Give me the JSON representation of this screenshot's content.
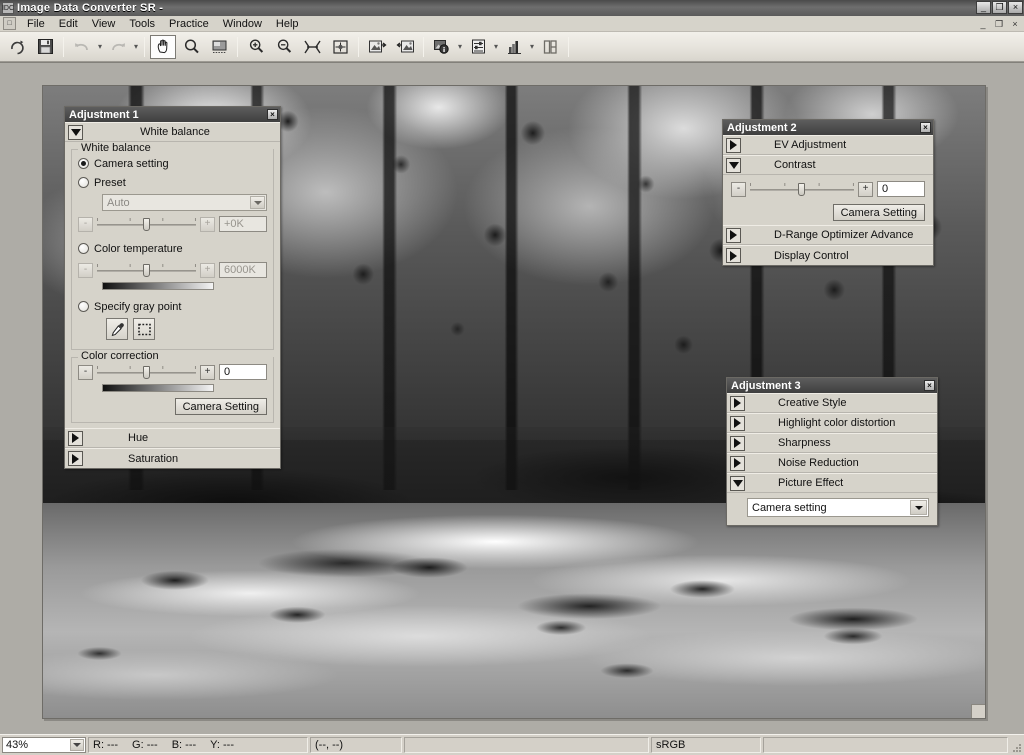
{
  "window": {
    "title": "Image Data Converter SR -",
    "app_icon": "app-icon",
    "controls": {
      "minimize": "_",
      "maximize": "❐",
      "close": "×"
    },
    "mdi_controls": {
      "minimize": "_",
      "restore": "❐",
      "close": "×"
    }
  },
  "menubar": {
    "items": [
      {
        "label": "File"
      },
      {
        "label": "Edit"
      },
      {
        "label": "View"
      },
      {
        "label": "Tools"
      },
      {
        "label": "Practice"
      },
      {
        "label": "Window"
      },
      {
        "label": "Help"
      }
    ]
  },
  "toolbar": {
    "buttons": [
      {
        "name": "rotate-icon",
        "glyph": "rotate",
        "state": "enabled"
      },
      {
        "name": "save-icon",
        "glyph": "save",
        "state": "enabled"
      },
      {
        "name": "undo-icon",
        "glyph": "undo",
        "state": "disabled"
      },
      {
        "name": "redo-icon",
        "glyph": "redo",
        "state": "disabled"
      },
      {
        "name": "hand-tool-icon",
        "glyph": "hand",
        "state": "active"
      },
      {
        "name": "zoom-tool-icon",
        "glyph": "magnifier",
        "state": "enabled"
      },
      {
        "name": "crop-tool-icon",
        "glyph": "crop",
        "state": "enabled"
      },
      {
        "name": "zoom-in-icon",
        "glyph": "zoom-in",
        "state": "enabled"
      },
      {
        "name": "zoom-out-icon",
        "glyph": "zoom-out",
        "state": "enabled"
      },
      {
        "name": "fit-screen-icon",
        "glyph": "fit",
        "state": "enabled"
      },
      {
        "name": "actual-pixels-icon",
        "glyph": "actual",
        "state": "enabled"
      },
      {
        "name": "import-image-icon",
        "glyph": "import",
        "state": "enabled"
      },
      {
        "name": "export-image-icon",
        "glyph": "export",
        "state": "enabled"
      },
      {
        "name": "image-info-icon",
        "glyph": "info",
        "state": "enabled"
      },
      {
        "name": "adjustment-icon",
        "glyph": "sliders",
        "state": "enabled"
      },
      {
        "name": "histogram-icon",
        "glyph": "histogram",
        "state": "enabled"
      },
      {
        "name": "compare-view-icon",
        "glyph": "compare",
        "state": "enabled"
      }
    ]
  },
  "adjustment1": {
    "title": "Adjustment 1",
    "close_label": "×",
    "white_balance_section": {
      "label": "White balance",
      "expanded": true
    },
    "white_balance_group": {
      "legend": "White balance",
      "camera_setting": {
        "label": "Camera setting",
        "checked": true
      },
      "preset": {
        "label": "Preset",
        "checked": false
      },
      "preset_combo_value": "Auto",
      "preset_minus": "-",
      "preset_plus": "+",
      "preset_field_value": "+0K",
      "color_temperature": {
        "label": "Color temperature",
        "checked": false
      },
      "ct_minus": "-",
      "ct_plus": "+",
      "ct_field_value": "6000K",
      "specify_gray_point": {
        "label": "Specify gray point",
        "checked": false
      },
      "eyedropper_icon": "eyedropper-icon",
      "marquee_icon": "marquee-icon"
    },
    "color_correction_group": {
      "legend": "Color correction",
      "minus": "-",
      "plus": "+",
      "field_value": "0",
      "camera_setting_button": "Camera Setting"
    },
    "hue_section": {
      "label": "Hue",
      "expanded": false
    },
    "saturation_section": {
      "label": "Saturation",
      "expanded": false
    }
  },
  "adjustment2": {
    "title": "Adjustment 2",
    "close_label": "×",
    "ev_adjustment": {
      "label": "EV Adjustment",
      "expanded": false
    },
    "contrast": {
      "label": "Contrast",
      "expanded": true
    },
    "contrast_minus": "-",
    "contrast_plus": "+",
    "contrast_value": "0",
    "camera_setting_button": "Camera Setting",
    "drange": {
      "label": "D-Range Optimizer Advance",
      "expanded": false
    },
    "display_control": {
      "label": "Display Control",
      "expanded": false
    }
  },
  "adjustment3": {
    "title": "Adjustment 3",
    "close_label": "×",
    "sections": [
      {
        "label": "Creative Style",
        "expanded": false
      },
      {
        "label": "Highlight color distortion",
        "expanded": false
      },
      {
        "label": "Sharpness",
        "expanded": false
      },
      {
        "label": "Noise Reduction",
        "expanded": false
      },
      {
        "label": "Picture Effect",
        "expanded": true
      }
    ],
    "picture_effect_value": "Camera setting"
  },
  "statusbar": {
    "zoom_value": "43%",
    "r_label": "R: ---",
    "g_label": "G: ---",
    "b_label": "B: ---",
    "y_label": "Y: ---",
    "coords": "(--, --)",
    "color_space": "sRGB",
    "extra": ""
  },
  "colors": {
    "window_face": "#d6d3ca",
    "title_bar": "#5a5a5a",
    "mdi_background": "#aeaca6",
    "palette_title": "#4a4a4a"
  }
}
